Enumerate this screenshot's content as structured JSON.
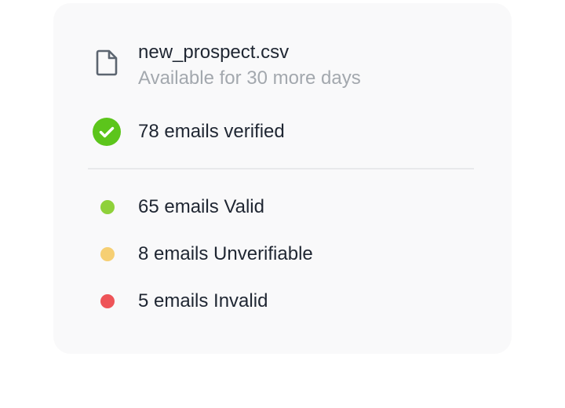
{
  "file": {
    "icon": "file-icon",
    "name": "new_prospect.csv",
    "availability": "Available for 30 more days"
  },
  "verification": {
    "icon": "check-circle-icon",
    "text": "78 emails verified",
    "color": "#5cc51b"
  },
  "stats": [
    {
      "text": "65 emails Valid",
      "color": "#8fd13a"
    },
    {
      "text": "8 emails Unverifiable",
      "color": "#f6cf73"
    },
    {
      "text": "5 emails Invalid",
      "color": "#ee5458"
    }
  ]
}
